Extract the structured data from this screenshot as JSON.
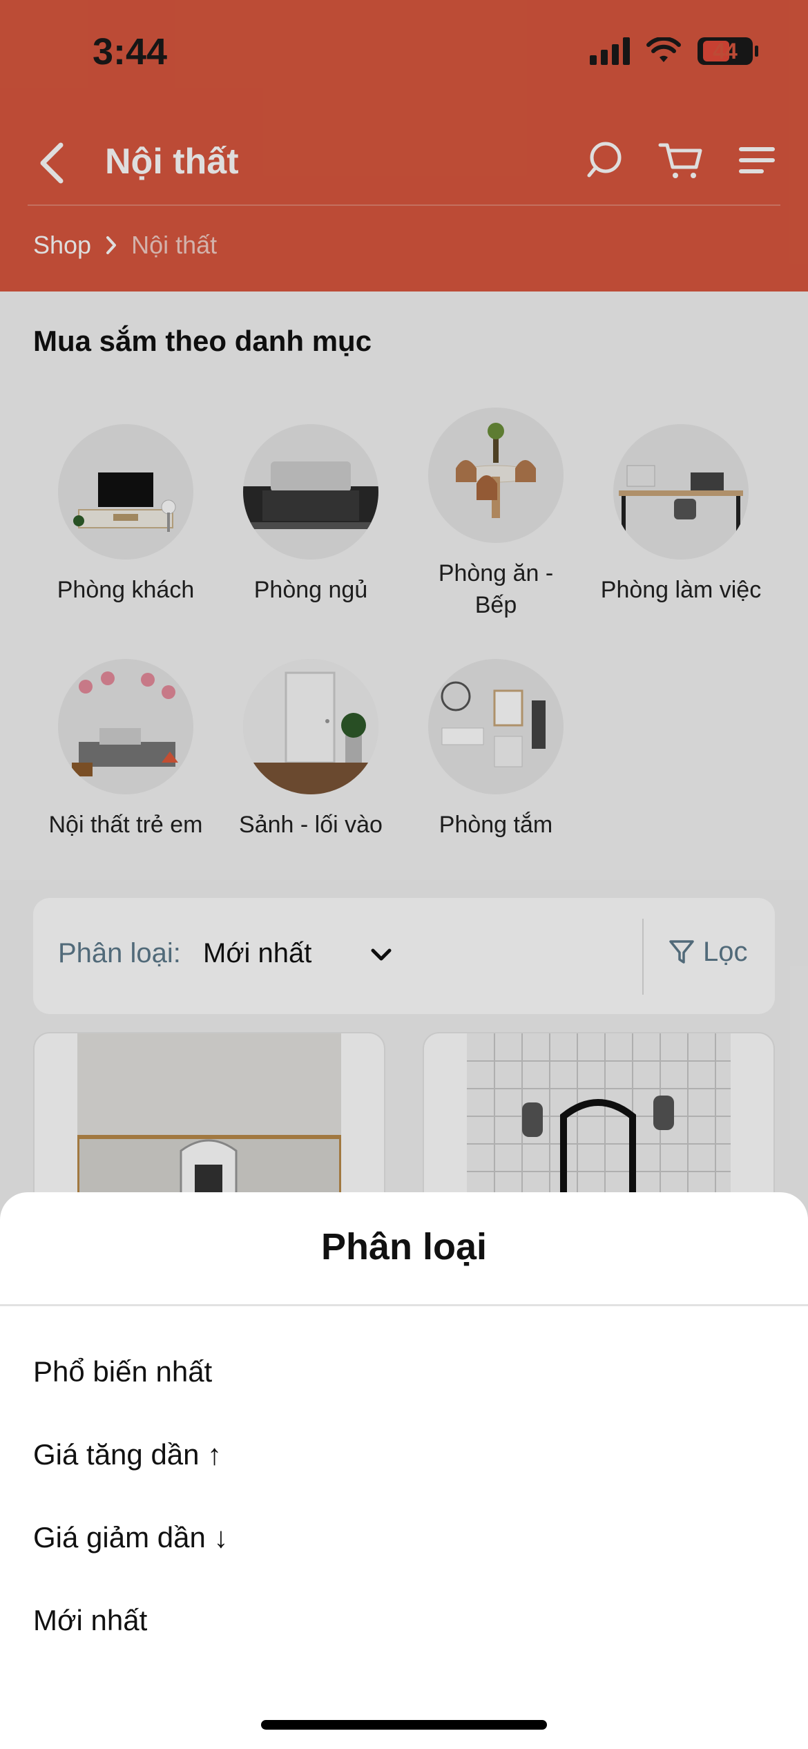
{
  "status": {
    "time": "3:44",
    "battery": "44"
  },
  "nav": {
    "title": "Nội thất"
  },
  "breadcrumb": {
    "root": "Shop",
    "current": "Nội thất"
  },
  "categories": {
    "heading": "Mua sắm theo danh mục",
    "items": [
      {
        "label": "Phòng khách"
      },
      {
        "label": "Phòng ngủ"
      },
      {
        "label": "Phòng ăn -\nBếp"
      },
      {
        "label": "Phòng làm việc"
      },
      {
        "label": "Nội thất trẻ em"
      },
      {
        "label": "Sảnh - lối vào"
      },
      {
        "label": "Phòng tắm"
      }
    ]
  },
  "sort": {
    "label": "Phân loại:",
    "value": "Mới nhất",
    "filter": "Lọc"
  },
  "sheet": {
    "title": "Phân loại",
    "options": [
      {
        "label": "Phổ biến nhất"
      },
      {
        "label": "Giá tăng dần ↑"
      },
      {
        "label": "Giá giảm dần ↓"
      },
      {
        "label": "Mới nhất"
      }
    ]
  },
  "colors": {
    "brand": "#d8573e",
    "muted": "#5d7a8c"
  }
}
